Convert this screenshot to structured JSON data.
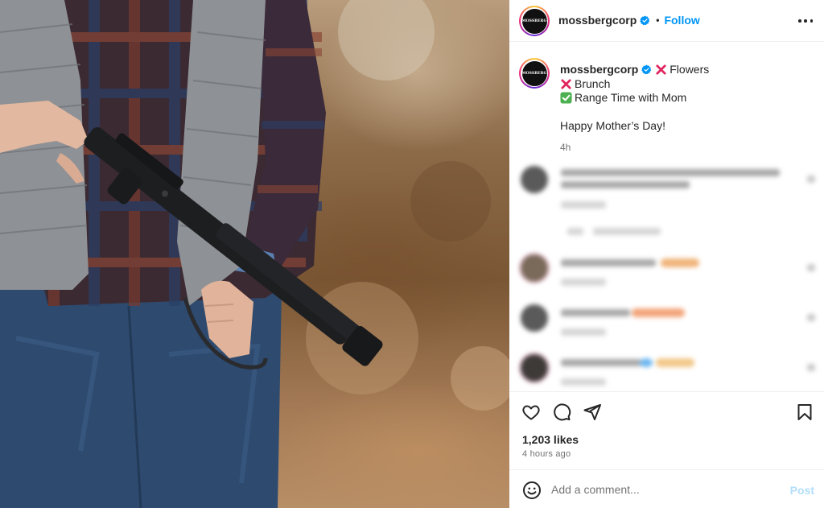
{
  "post": {
    "username": "mossbergcorp",
    "follow_label": "Follow",
    "dot": "•",
    "logo_text": "MOSSBERG"
  },
  "caption": {
    "username": "mossbergcorp",
    "line1": "Flowers",
    "line2": "Brunch",
    "line3": "Range Time with Mom",
    "line4": "Happy Mother’s Day!",
    "time": "4h"
  },
  "stats": {
    "likes": "1,203 likes",
    "time_ago": "4 hours ago"
  },
  "comment_box": {
    "placeholder": "Add a comment...",
    "post_label": "Post"
  },
  "colors": {
    "accent": "#0095f6",
    "verified": "#0095f6",
    "post_disabled": "#b2dffc",
    "cross": "#e0245e",
    "check": "#4cb050"
  },
  "icons": {
    "like": "heart-icon",
    "comment": "comment-icon",
    "share": "paper-plane-icon",
    "save": "bookmark-icon",
    "emoji": "smiley-icon",
    "more": "more-horizontal-icon"
  }
}
